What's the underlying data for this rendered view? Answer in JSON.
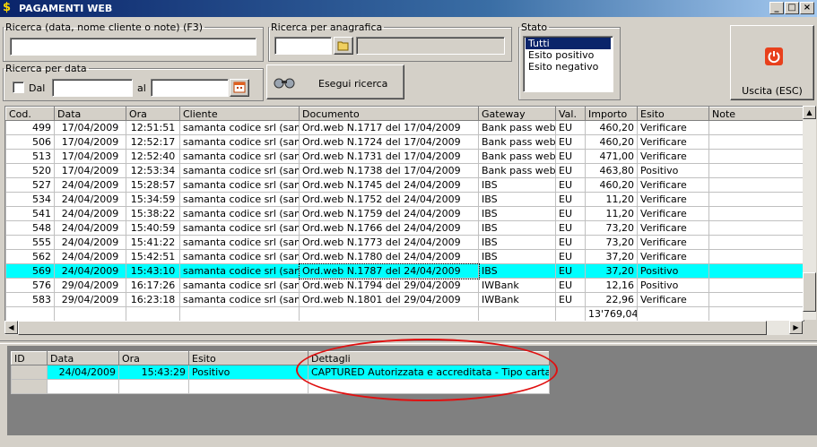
{
  "window": {
    "title": "PAGAMENTI WEB",
    "minimize": "_",
    "maximize": "□",
    "close": "×",
    "app_icon": "dollar-icon"
  },
  "search_general": {
    "legend": "Ricerca (data, nome cliente o note) (F3)",
    "value": ""
  },
  "search_anagrafica": {
    "legend": "Ricerca per anagrafica",
    "code_value": "",
    "name_value": "",
    "icon": "folder-icon"
  },
  "search_date": {
    "legend": "Ricerca per data",
    "checkbox_label": "Dal",
    "from_value": "",
    "to_label": "al",
    "to_value": "",
    "icon": "calendar-icon"
  },
  "run_button": {
    "label": "Esegui ricerca",
    "icon": "binoculars-icon"
  },
  "stato": {
    "legend": "Stato",
    "options": [
      "Tutti",
      "Esito positivo",
      "Esito negativo"
    ],
    "selected": "Tutti"
  },
  "exit_button": {
    "label": "Uscita (ESC)",
    "icon": "power-icon",
    "color": "#e8401c"
  },
  "main_grid": {
    "columns": [
      "Cod.",
      "Data",
      "Ora",
      "Cliente",
      "Documento",
      "Gateway",
      "Val.",
      "Importo",
      "Esito",
      "Note"
    ],
    "rows": [
      [
        "499",
        "17/04/2009",
        "12:51:51",
        "samanta codice srl (sam/...",
        "Ord.web N.1717 del 17/04/2009",
        "Bank pass web",
        "EU",
        "460,20",
        "Verificare",
        ""
      ],
      [
        "506",
        "17/04/2009",
        "12:52:17",
        "samanta codice srl (sam/...",
        "Ord.web N.1724 del 17/04/2009",
        "Bank pass web",
        "EU",
        "460,20",
        "Verificare",
        ""
      ],
      [
        "513",
        "17/04/2009",
        "12:52:40",
        "samanta codice srl (sam/...",
        "Ord.web N.1731 del 17/04/2009",
        "Bank pass web",
        "EU",
        "471,00",
        "Verificare",
        ""
      ],
      [
        "520",
        "17/04/2009",
        "12:53:34",
        "samanta codice srl (sam/...",
        "Ord.web N.1738 del 17/04/2009",
        "Bank pass web",
        "EU",
        "463,80",
        "Positivo",
        ""
      ],
      [
        "527",
        "24/04/2009",
        "15:28:57",
        "samanta codice srl (sam/...",
        "Ord.web N.1745 del 24/04/2009",
        "IBS",
        "EU",
        "460,20",
        "Verificare",
        ""
      ],
      [
        "534",
        "24/04/2009",
        "15:34:59",
        "samanta codice srl (sam/...",
        "Ord.web N.1752 del 24/04/2009",
        "IBS",
        "EU",
        "11,20",
        "Verificare",
        ""
      ],
      [
        "541",
        "24/04/2009",
        "15:38:22",
        "samanta codice srl (sam/...",
        "Ord.web N.1759 del 24/04/2009",
        "IBS",
        "EU",
        "11,20",
        "Verificare",
        ""
      ],
      [
        "548",
        "24/04/2009",
        "15:40:59",
        "samanta codice srl (sam/...",
        "Ord.web N.1766 del 24/04/2009",
        "IBS",
        "EU",
        "73,20",
        "Verificare",
        ""
      ],
      [
        "555",
        "24/04/2009",
        "15:41:22",
        "samanta codice srl (sam/...",
        "Ord.web N.1773 del 24/04/2009",
        "IBS",
        "EU",
        "73,20",
        "Verificare",
        ""
      ],
      [
        "562",
        "24/04/2009",
        "15:42:51",
        "samanta codice srl (sam/...",
        "Ord.web N.1780 del 24/04/2009",
        "IBS",
        "EU",
        "37,20",
        "Verificare",
        ""
      ],
      [
        "569",
        "24/04/2009",
        "15:43:10",
        "samanta codice srl (sam/...",
        "Ord.web N.1787 del 24/04/2009",
        "IBS",
        "EU",
        "37,20",
        "Positivo",
        ""
      ],
      [
        "576",
        "29/04/2009",
        "16:17:26",
        "samanta codice srl (sam/...",
        "Ord.web N.1794 del 29/04/2009",
        "IWBank",
        "EU",
        "12,16",
        "Positivo",
        ""
      ],
      [
        "583",
        "29/04/2009",
        "16:23:18",
        "samanta codice srl (sam/...",
        "Ord.web N.1801 del 29/04/2009",
        "IWBank",
        "EU",
        "22,96",
        "Verificare",
        ""
      ]
    ],
    "highlighted_row": 10,
    "total": "13'769,04"
  },
  "detail_grid": {
    "columns": [
      "ID",
      "Data",
      "Ora",
      "Esito",
      "Dettagli"
    ],
    "rows": [
      [
        "",
        "24/04/2009",
        "15:43:29",
        "Positivo",
        "CAPTURED Autorizzata e accreditata - Tipo carta: VI..."
      ]
    ]
  },
  "colors": {
    "highlight": "#00ffff",
    "selection": "#0a246a",
    "annotation": "#e01010"
  }
}
